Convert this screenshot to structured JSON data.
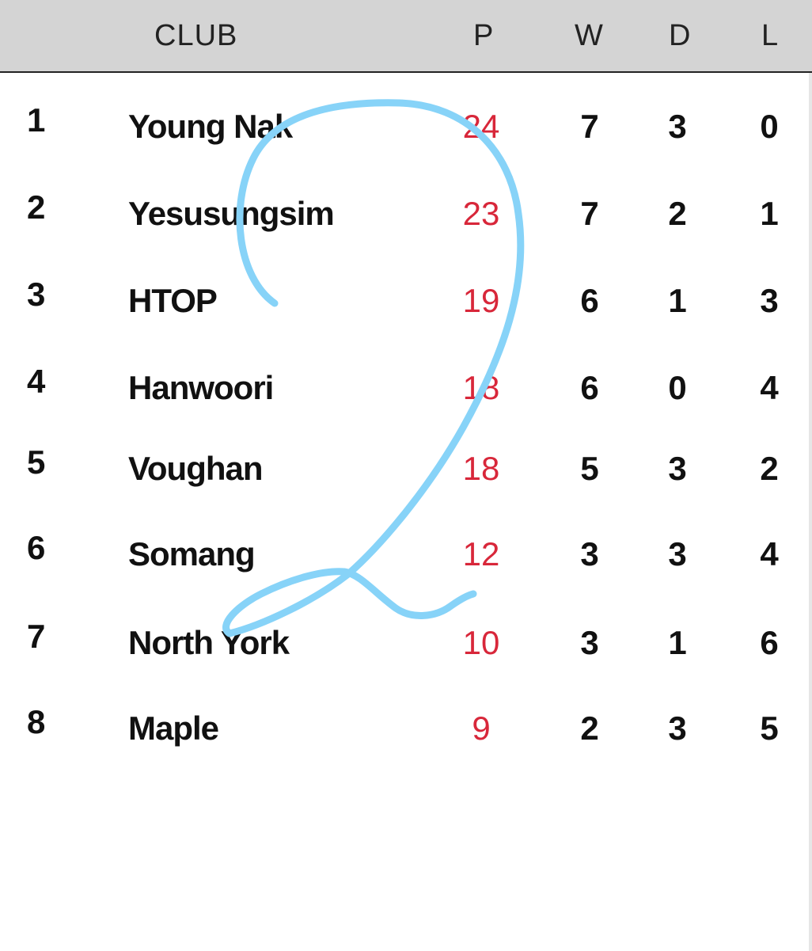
{
  "header": {
    "club": "CLUB",
    "p": "P",
    "w": "W",
    "d": "D",
    "l": "L"
  },
  "rows": [
    {
      "rank": "1",
      "club": "Young Nak",
      "p": "24",
      "w": "7",
      "d": "3",
      "l": "0"
    },
    {
      "rank": "2",
      "club": "Yesusungsim",
      "p": "23",
      "w": "7",
      "d": "2",
      "l": "1"
    },
    {
      "rank": "3",
      "club": "HTOP",
      "p": "19",
      "w": "6",
      "d": "1",
      "l": "3"
    },
    {
      "rank": "4",
      "club": "Hanwoori",
      "p": "18",
      "w": "6",
      "d": "0",
      "l": "4"
    },
    {
      "rank": "5",
      "club": "Voughan",
      "p": "18",
      "w": "5",
      "d": "3",
      "l": "2"
    },
    {
      "rank": "6",
      "club": "Somang",
      "p": "12",
      "w": "3",
      "d": "3",
      "l": "4"
    },
    {
      "rank": "7",
      "club": "North York",
      "p": "10",
      "w": "3",
      "d": "1",
      "l": "6"
    },
    {
      "rank": "8",
      "club": "Maple",
      "p": "9",
      "w": "2",
      "d": "3",
      "l": "5"
    }
  ],
  "colors": {
    "header_bg": "#d4d4d4",
    "points": "#d8273a",
    "scribble": "#87d3f8"
  }
}
